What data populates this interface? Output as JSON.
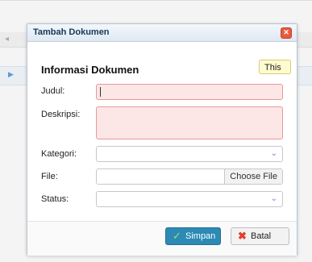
{
  "dialog": {
    "title": "Tambah Dokumen",
    "close_icon_glyph": "✕",
    "section_heading": "Informasi Dokumen",
    "fields": {
      "judul_label": "Judul:",
      "deskripsi_label": "Deskripsi:",
      "kategori_label": "Kategori:",
      "file_label": "File:",
      "status_label": "Status:"
    },
    "file_button": "Choose File",
    "tooltip_text": "This",
    "buttons": {
      "save": "Simpan",
      "cancel": "Batal"
    }
  },
  "colors": {
    "error_bg": "#fde6e6",
    "error_border": "#e69a9a",
    "save_button": "#2c8ab4",
    "close_button": "#e85a3e"
  },
  "icons": {
    "close": "close-icon",
    "select": "chevron-down-icon",
    "save": "check-icon",
    "cancel": "x-icon"
  }
}
